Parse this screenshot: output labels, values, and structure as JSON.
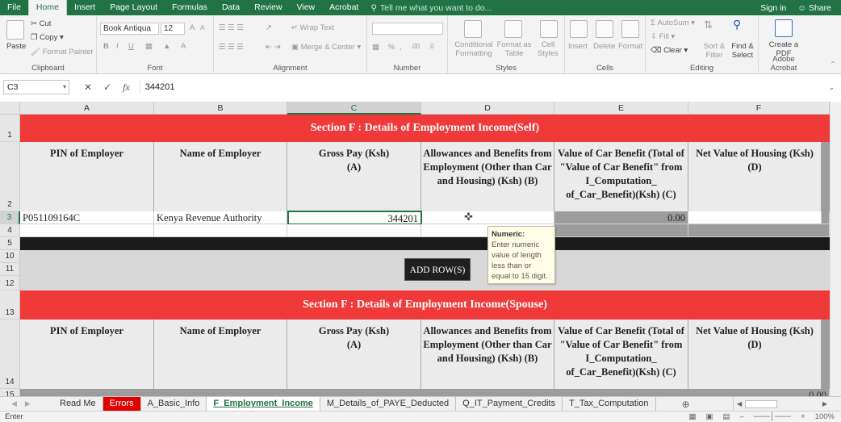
{
  "ribbon_tabs": [
    "File",
    "Home",
    "Insert",
    "Page Layout",
    "Formulas",
    "Data",
    "Review",
    "View",
    "Acrobat"
  ],
  "tell_me": "Tell me what you want to do...",
  "sign_in": "Sign in",
  "share": "Share",
  "ribbon": {
    "clipboard": {
      "paste": "Paste",
      "cut": "Cut",
      "copy": "Copy",
      "format_painter": "Format Painter",
      "label": "Clipboard"
    },
    "font": {
      "name": "Book Antiqua",
      "size": "12",
      "label": "Font",
      "bold": "B",
      "italic": "I",
      "underline": "U",
      "grow": "A",
      "shrink": "A"
    },
    "alignment": {
      "wrap": "Wrap Text",
      "merge": "Merge & Center",
      "label": "Alignment"
    },
    "number": {
      "percent": "%",
      "comma": ",",
      "label": "Number",
      "inc_dec": ".00",
      "dec_dec": ".0"
    },
    "styles": {
      "conditional": "Conditional Formatting",
      "format_table": "Format as Table",
      "cell_styles": "Cell Styles",
      "label": "Styles"
    },
    "cells": {
      "insert": "Insert",
      "delete": "Delete",
      "format": "Format",
      "label": "Cells"
    },
    "editing": {
      "autosum": "AutoSum",
      "fill": "Fill",
      "clear": "Clear",
      "sort": "Sort & Filter",
      "find": "Find & Select",
      "label": "Editing"
    },
    "acrobat": {
      "create": "Create a PDF",
      "label": "Adobe Acrobat"
    }
  },
  "formula_bar": {
    "name_box": "C3",
    "value": "344201",
    "fx": "fx"
  },
  "columns": [
    "A",
    "B",
    "C",
    "D",
    "E",
    "F"
  ],
  "rows": [
    "1",
    "2",
    "3",
    "4",
    "5",
    "10",
    "11",
    "12",
    "13",
    "14",
    "15"
  ],
  "section_self": "Section F : Details of Employment Income(Self)",
  "section_spouse": "Section F : Details of Employment Income(Spouse)",
  "headers": [
    "PIN of Employer",
    "Name of Employer",
    "Gross Pay (Ksh)\n(A)",
    "Allowances and Benefits from Employment (Other than Car and Housing) (Ksh) (B)",
    "Value of Car Benefit (Total of \"Value of Car Benefit\" from I_Computation_ of_Car_Benefit)(Ksh) (C)",
    "Net Value of Housing (Ksh)\n(D)"
  ],
  "row3": {
    "pin": "P051109164C",
    "name": "Kenya Revenue Authority",
    "gross": "344201",
    "car": "0.00"
  },
  "row15_value": "0.00",
  "add_row": "ADD ROW(S)",
  "tooltip": {
    "title": "Numeric:",
    "body": "Enter numeric value of length less than or equal to 15 digit."
  },
  "sheets": [
    "Read Me",
    "Errors",
    "A_Basic_Info",
    "F_Employment_Income",
    "M_Details_of_PAYE_Deducted",
    "Q_IT_Payment_Credits",
    "T_Tax_Computation"
  ],
  "status": {
    "mode": "Enter",
    "zoom": "100%"
  }
}
